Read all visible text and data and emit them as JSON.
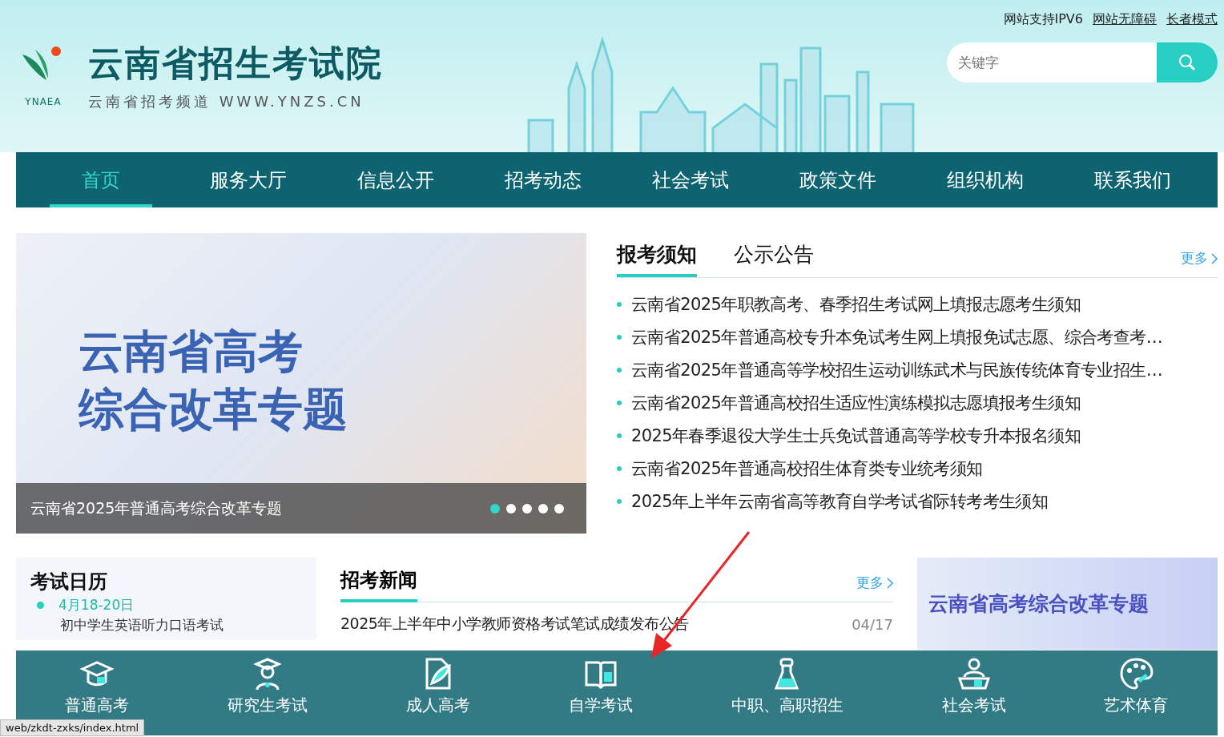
{
  "header": {
    "logo_text": "YNAEA",
    "title": "云南省招生考试院",
    "subtitle": "云南省招考频道 WWW.YNZS.CN",
    "top_links": [
      {
        "label": "网站支持IPV6",
        "underlined": false
      },
      {
        "label": "网站无障碍",
        "underlined": true
      },
      {
        "label": "长者模式",
        "underlined": true
      }
    ],
    "search": {
      "placeholder": "关键字"
    }
  },
  "nav": [
    {
      "label": "首页",
      "selected": true
    },
    {
      "label": "服务大厅",
      "selected": false
    },
    {
      "label": "信息公开",
      "selected": false
    },
    {
      "label": "招考动态",
      "selected": false
    },
    {
      "label": "社会考试",
      "selected": false
    },
    {
      "label": "政策文件",
      "selected": false
    },
    {
      "label": "组织机构",
      "selected": false
    },
    {
      "label": "联系我们",
      "selected": false
    }
  ],
  "carousel": {
    "title_lines": [
      "云南省高考",
      "综合改革专题"
    ],
    "caption": "云南省2025年普通高考综合改革专题",
    "dots": [
      {
        "selected": true
      },
      {
        "selected": false
      },
      {
        "selected": false
      },
      {
        "selected": false
      },
      {
        "selected": false
      }
    ]
  },
  "notices": {
    "tabs": [
      {
        "label": "报考须知",
        "selected": true
      },
      {
        "label": "公示公告",
        "selected": false
      }
    ],
    "more": "更多",
    "items": [
      "云南省2025年职教高考、春季招生考试网上填报志愿考生须知",
      "云南省2025年普通高校专升本免试考生网上填报免试志愿、综合考查考…",
      "云南省2025年普通高等学校招生运动训练武术与民族传统体育专业招生…",
      "云南省2025年普通高校招生适应性演练模拟志愿填报考生须知",
      "2025年春季退役大学生士兵免试普通高等学校专升本报名须知",
      "云南省2025年普通高校招生体育类专业统考须知",
      "2025年上半年云南省高等教育自学考试省际转考考生须知"
    ]
  },
  "calendar": {
    "title": "考试日历",
    "entries": [
      {
        "date": "4月18-20日",
        "name": "初中学生英语听力口语考试"
      }
    ]
  },
  "news": {
    "title": "招考新闻",
    "more": "更多",
    "rows": [
      {
        "title": "2025年上半年中小学教师资格考试笔试成绩发布公告",
        "date": "04/17"
      }
    ]
  },
  "side_banners": [
    {
      "title": "云南省高考综合改革专题"
    }
  ],
  "quick_bar": [
    {
      "label": "普通高考",
      "kind": "cap"
    },
    {
      "label": "研究生考试",
      "kind": "graduate"
    },
    {
      "label": "成人高考",
      "kind": "feather"
    },
    {
      "label": "自学考试",
      "kind": "book"
    },
    {
      "label": "中职、高职招生",
      "kind": "flask"
    },
    {
      "label": "社会考试",
      "kind": "desk"
    },
    {
      "label": "艺术体育",
      "kind": "palette"
    }
  ],
  "status_bar": "web/zkdt-zxks/index.html"
}
